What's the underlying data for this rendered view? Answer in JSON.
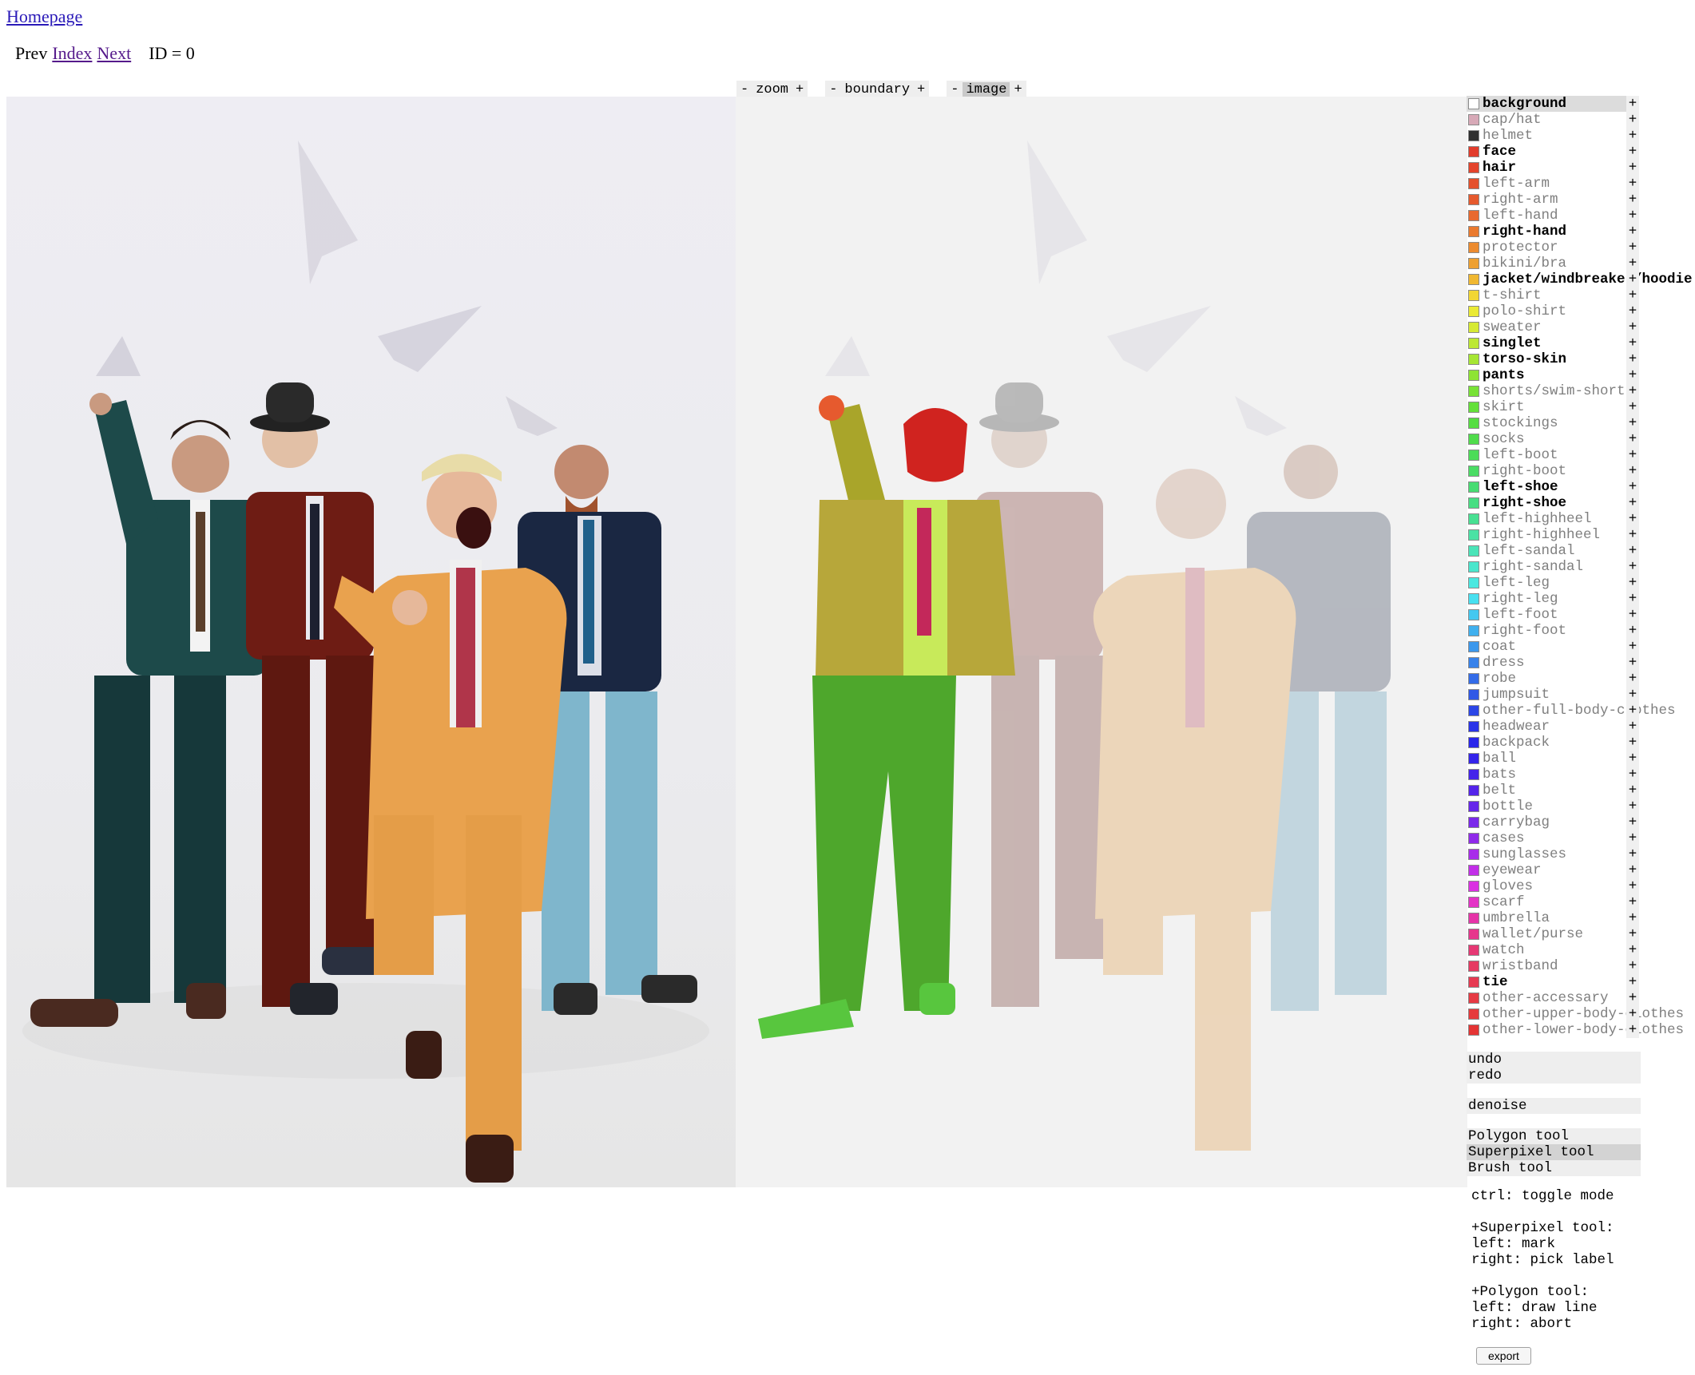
{
  "nav": {
    "homepage": "Homepage",
    "prev": "Prev",
    "index": "Index",
    "next": "Next",
    "id": "ID = 0"
  },
  "controls": [
    {
      "name": "zoom",
      "minus": "-",
      "plus": "+",
      "active": false
    },
    {
      "name": "boundary",
      "minus": "-",
      "plus": "+",
      "active": false
    },
    {
      "name": "image",
      "minus": "-",
      "plus": "+",
      "active": true
    }
  ],
  "labels": [
    {
      "name": "background",
      "color": "#ffffff",
      "bold": true,
      "selected": true
    },
    {
      "name": "cap/hat",
      "color": "#d7a9b7",
      "bold": false
    },
    {
      "name": "helmet",
      "color": "#2f2f2f",
      "bold": false
    },
    {
      "name": "face",
      "color": "#e23c2c",
      "bold": true
    },
    {
      "name": "hair",
      "color": "#e4442c",
      "bold": true
    },
    {
      "name": "left-arm",
      "color": "#e4502c",
      "bold": false
    },
    {
      "name": "right-arm",
      "color": "#e65a2e",
      "bold": false
    },
    {
      "name": "left-hand",
      "color": "#e8692f",
      "bold": false
    },
    {
      "name": "right-hand",
      "color": "#ea7a2f",
      "bold": true
    },
    {
      "name": "protector",
      "color": "#ec8b30",
      "bold": false
    },
    {
      "name": "bikini/bra",
      "color": "#eea031",
      "bold": false
    },
    {
      "name": "jacket/windbreaker/hoodie",
      "color": "#f0b832",
      "bold": true
    },
    {
      "name": "t-shirt",
      "color": "#f2d634",
      "bold": false
    },
    {
      "name": "polo-shirt",
      "color": "#eaea34",
      "bold": false
    },
    {
      "name": "sweater",
      "color": "#d6ea34",
      "bold": false
    },
    {
      "name": "singlet",
      "color": "#bde834",
      "bold": true
    },
    {
      "name": "torso-skin",
      "color": "#a6e634",
      "bold": true
    },
    {
      "name": "pants",
      "color": "#8ee434",
      "bold": true
    },
    {
      "name": "shorts/swim-shorts",
      "color": "#78e236",
      "bold": false
    },
    {
      "name": "skirt",
      "color": "#64e03a",
      "bold": false
    },
    {
      "name": "stockings",
      "color": "#56de42",
      "bold": false
    },
    {
      "name": "socks",
      "color": "#50dc4c",
      "bold": false
    },
    {
      "name": "left-boot",
      "color": "#4cdc58",
      "bold": false
    },
    {
      "name": "right-boot",
      "color": "#4adc64",
      "bold": false
    },
    {
      "name": "left-shoe",
      "color": "#48dc72",
      "bold": true
    },
    {
      "name": "right-shoe",
      "color": "#48de82",
      "bold": true
    },
    {
      "name": "left-highheel",
      "color": "#48e092",
      "bold": false
    },
    {
      "name": "right-highheel",
      "color": "#4ae2a4",
      "bold": false
    },
    {
      "name": "left-sandal",
      "color": "#4ae4b8",
      "bold": false
    },
    {
      "name": "right-sandal",
      "color": "#4ae6cc",
      "bold": false
    },
    {
      "name": "left-leg",
      "color": "#4ae8e0",
      "bold": false
    },
    {
      "name": "right-leg",
      "color": "#48e0f0",
      "bold": false
    },
    {
      "name": "left-foot",
      "color": "#44c8f0",
      "bold": false
    },
    {
      "name": "right-foot",
      "color": "#40b0ee",
      "bold": false
    },
    {
      "name": "coat",
      "color": "#3c98ec",
      "bold": false
    },
    {
      "name": "dress",
      "color": "#3882ea",
      "bold": false
    },
    {
      "name": "robe",
      "color": "#346ce8",
      "bold": false
    },
    {
      "name": "jumpsuit",
      "color": "#3058e6",
      "bold": false
    },
    {
      "name": "other-full-body-clothes",
      "color": "#2c46e6",
      "bold": false
    },
    {
      "name": "headwear",
      "color": "#2a34e8",
      "bold": false
    },
    {
      "name": "backpack",
      "color": "#2a26ea",
      "bold": false
    },
    {
      "name": "ball",
      "color": "#3424ea",
      "bold": false
    },
    {
      "name": "bats",
      "color": "#4424ea",
      "bold": false
    },
    {
      "name": "belt",
      "color": "#5424ea",
      "bold": false
    },
    {
      "name": "bottle",
      "color": "#6626ea",
      "bold": false
    },
    {
      "name": "carrybag",
      "color": "#7a28ea",
      "bold": false
    },
    {
      "name": "cases",
      "color": "#902aea",
      "bold": false
    },
    {
      "name": "sunglasses",
      "color": "#a82cea",
      "bold": false
    },
    {
      "name": "eyewear",
      "color": "#c22ee8",
      "bold": false
    },
    {
      "name": "gloves",
      "color": "#da30e2",
      "bold": false
    },
    {
      "name": "scarf",
      "color": "#e432c6",
      "bold": false
    },
    {
      "name": "umbrella",
      "color": "#e634a8",
      "bold": false
    },
    {
      "name": "wallet/purse",
      "color": "#e6368c",
      "bold": false
    },
    {
      "name": "watch",
      "color": "#e63874",
      "bold": false
    },
    {
      "name": "wristband",
      "color": "#e63a62",
      "bold": false
    },
    {
      "name": "tie",
      "color": "#e63a52",
      "bold": true
    },
    {
      "name": "other-accessary",
      "color": "#e63a44",
      "bold": false
    },
    {
      "name": "other-upper-body-clothes",
      "color": "#e63a3c",
      "bold": false
    },
    {
      "name": "other-lower-body-clothes",
      "color": "#e43434",
      "bold": false
    }
  ],
  "plus": "+",
  "actions": {
    "undo": "undo",
    "redo": "redo",
    "denoise": "denoise"
  },
  "tools": {
    "polygon": "Polygon tool",
    "superpixel": "Superpixel tool",
    "brush": "Brush tool"
  },
  "help": "ctrl: toggle mode\n\n+Superpixel tool:\nleft: mark\nright: pick label\n\n+Polygon tool:\nleft: draw line\nright: abort",
  "export": "export"
}
